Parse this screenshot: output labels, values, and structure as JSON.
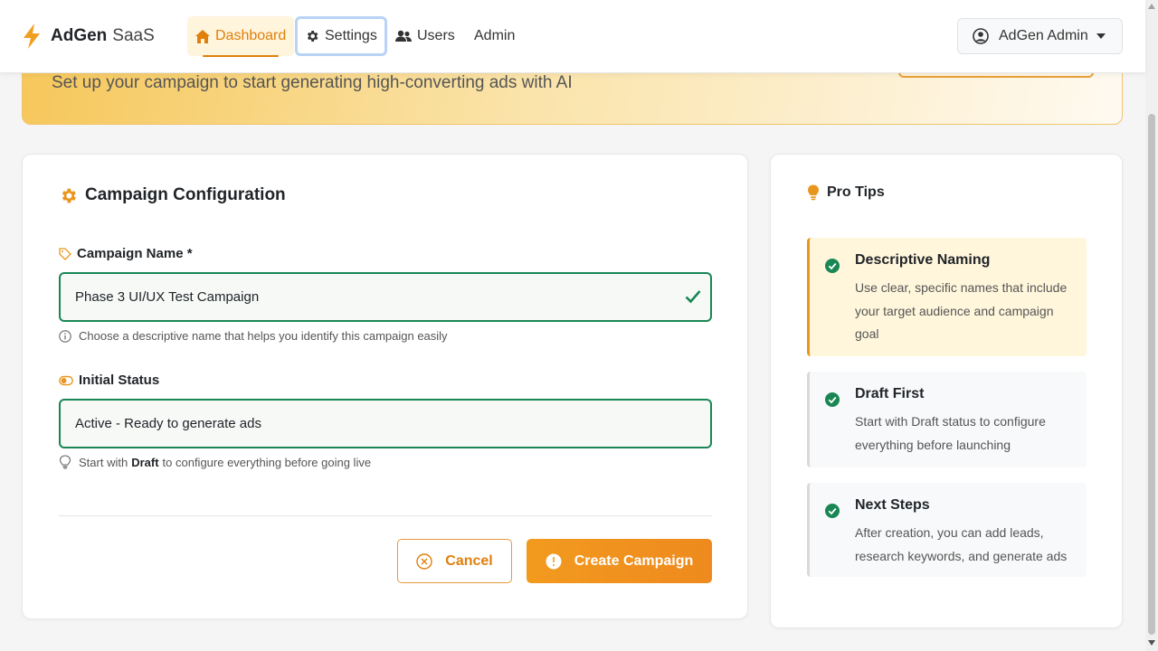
{
  "brand": {
    "name_bold": "AdGen",
    "name_light": "SaaS"
  },
  "nav": {
    "dashboard": "Dashboard",
    "settings": "Settings",
    "users": "Users",
    "admin": "Admin"
  },
  "user_menu": {
    "name": "AdGen Admin"
  },
  "hero": {
    "subtitle": "Set up your campaign to start generating high-converting ads with AI"
  },
  "form": {
    "title": "Campaign Configuration",
    "name_label": "Campaign Name *",
    "name_value": "Phase 3 UI/UX Test Campaign",
    "name_help": "Choose a descriptive name that helps you identify this campaign easily",
    "status_label": "Initial Status",
    "status_value": "Active - Ready to generate ads",
    "status_help_pre": "Start with",
    "status_help_bold": "Draft",
    "status_help_post": "to configure everything before going live",
    "cancel": "Cancel",
    "create": "Create Campaign"
  },
  "tips": {
    "title": "Pro Tips",
    "items": [
      {
        "title": "Descriptive Naming",
        "text": "Use clear, specific names that include your target audience and campaign goal"
      },
      {
        "title": "Draft First",
        "text": "Start with Draft status to configure everything before launching"
      },
      {
        "title": "Next Steps",
        "text": "After creation, you can add leads, research keywords, and generate ads"
      }
    ]
  },
  "colors": {
    "accent": "#e07f0c",
    "success": "#198754",
    "warning_bg": "#fff6dc"
  },
  "icons": [
    "bolt-icon",
    "home-icon",
    "gear-icon",
    "users-icon",
    "user-circle-icon",
    "tag-icon",
    "check-icon",
    "info-icon",
    "toggle-icon",
    "lightbulb-icon",
    "cancel-icon",
    "check-circle-icon"
  ]
}
